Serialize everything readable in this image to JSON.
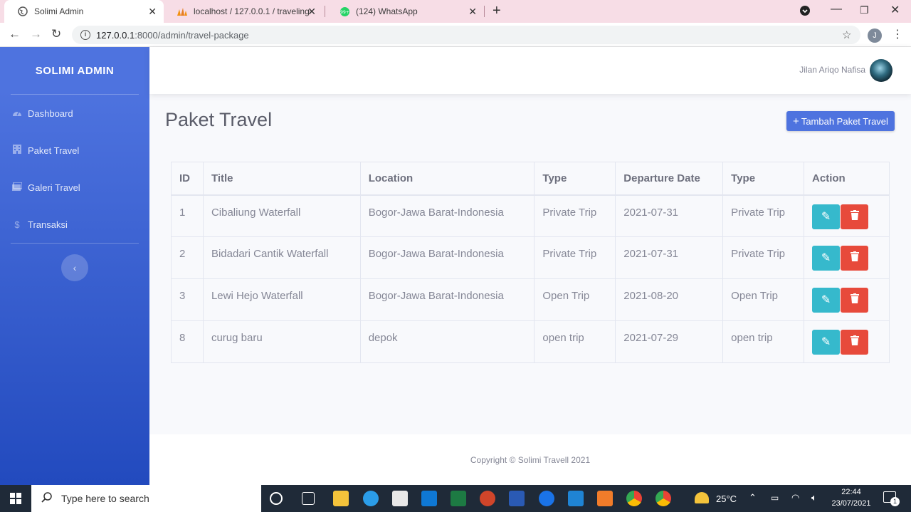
{
  "browser": {
    "tabs": [
      {
        "title": "Solimi Admin",
        "active": true
      },
      {
        "title": "localhost / 127.0.0.1 / travelingku",
        "active": false
      },
      {
        "title": "(124) WhatsApp",
        "active": false
      }
    ],
    "url_host": "127.0.0.1",
    "url_rest": ":8000/admin/travel-package",
    "profile_initial": "J"
  },
  "sidebar": {
    "brand": "SOLIMI ADMIN",
    "items": [
      {
        "label": "Dashboard",
        "icon": "tachometer-icon"
      },
      {
        "label": "Paket Travel",
        "icon": "building-icon"
      },
      {
        "label": "Galeri Travel",
        "icon": "images-icon"
      },
      {
        "label": "Transaksi",
        "icon": "dollar-icon"
      }
    ]
  },
  "topbar": {
    "username": "Jilan Ariqo Nafisa"
  },
  "page": {
    "title": "Paket Travel",
    "add_button": "Tambah Paket Travel"
  },
  "table": {
    "headers": [
      "ID",
      "Title",
      "Location",
      "Type",
      "Departure Date",
      "Type",
      "Action"
    ],
    "rows": [
      {
        "id": "1",
        "title": "Cibaliung Waterfall",
        "location": "Bogor-Jawa Barat-Indonesia",
        "type": "Private Trip",
        "departure_date": "2021-07-31",
        "type2": "Private Trip"
      },
      {
        "id": "2",
        "title": "Bidadari Cantik Waterfall",
        "location": "Bogor-Jawa Barat-Indonesia",
        "type": "Private Trip",
        "departure_date": "2021-07-31",
        "type2": "Private Trip"
      },
      {
        "id": "3",
        "title": "Lewi Hejo Waterfall",
        "location": "Bogor-Jawa Barat-Indonesia",
        "type": "Open Trip",
        "departure_date": "2021-08-20",
        "type2": "Open Trip"
      },
      {
        "id": "8",
        "title": "curug baru",
        "location": "depok",
        "type": "open trip",
        "departure_date": "2021-07-29",
        "type2": "open trip"
      }
    ]
  },
  "footer": {
    "copyright": "Copyright © Solimi Travell 2021"
  },
  "taskbar": {
    "search_placeholder": "Type here to search",
    "temperature": "25°C",
    "time": "22:44",
    "date": "23/07/2021",
    "notification_count": "1"
  },
  "colors": {
    "primary": "#4e73df",
    "info": "#36b9cc",
    "danger": "#e74a3b",
    "tab_bar": "#f7dde6"
  }
}
